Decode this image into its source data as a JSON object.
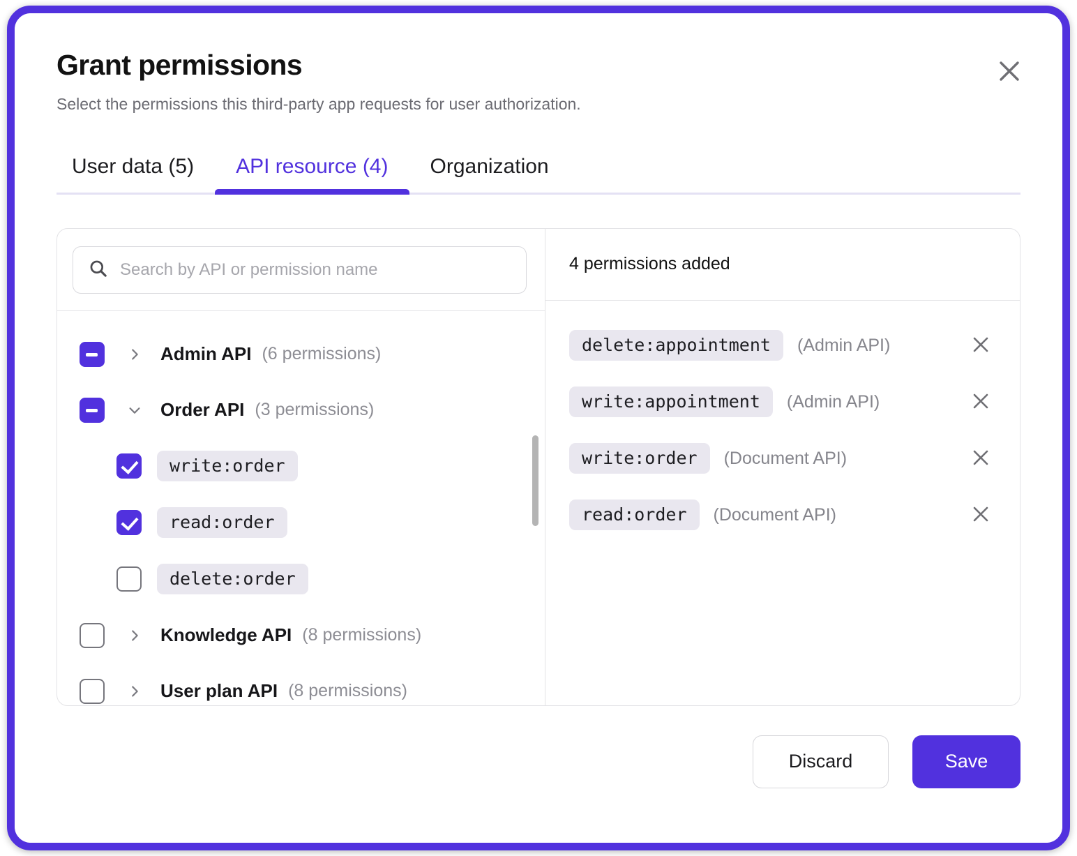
{
  "dialog": {
    "title": "Grant permissions",
    "subtitle": "Select the permissions this third-party app requests for user authorization.",
    "close_label": "Close",
    "accent_color": "#5131DE",
    "chip_bg_color": "#E9E7EF"
  },
  "tabs": [
    {
      "label": "User data (5)",
      "active": false
    },
    {
      "label": "API resource (4)",
      "active": true
    },
    {
      "label": "Organization",
      "active": false
    }
  ],
  "search": {
    "placeholder": "Search by API or permission name",
    "value": "",
    "icon": "search-icon"
  },
  "tree": [
    {
      "name": "Admin API",
      "count_label": "(6 permissions)",
      "checkbox_state": "indeterminate",
      "expanded": false,
      "chevron": "chevron-right-icon",
      "children": []
    },
    {
      "name": "Order API",
      "count_label": "(3 permissions)",
      "checkbox_state": "indeterminate",
      "expanded": true,
      "chevron": "chevron-down-icon",
      "children": [
        {
          "permission": "write:order",
          "checkbox_state": "checked"
        },
        {
          "permission": "read:order",
          "checkbox_state": "checked"
        },
        {
          "permission": "delete:order",
          "checkbox_state": "unchecked"
        }
      ]
    },
    {
      "name": "Knowledge API",
      "count_label": "(8 permissions)",
      "checkbox_state": "unchecked",
      "expanded": false,
      "chevron": "chevron-right-icon",
      "children": []
    },
    {
      "name": "User plan API",
      "count_label": "(8 permissions)",
      "checkbox_state": "unchecked",
      "expanded": false,
      "chevron": "chevron-right-icon",
      "children": []
    }
  ],
  "added_panel": {
    "heading": "4 permissions added",
    "items": [
      {
        "permission": "delete:appointment",
        "source": "(Admin API)",
        "remove_label": "Remove"
      },
      {
        "permission": "write:appointment",
        "source": "(Admin API)",
        "remove_label": "Remove"
      },
      {
        "permission": "write:order",
        "source": "(Document API)",
        "remove_label": "Remove"
      },
      {
        "permission": "read:order",
        "source": "(Document API)",
        "remove_label": "Remove"
      }
    ]
  },
  "footer": {
    "discard_label": "Discard",
    "save_label": "Save"
  }
}
